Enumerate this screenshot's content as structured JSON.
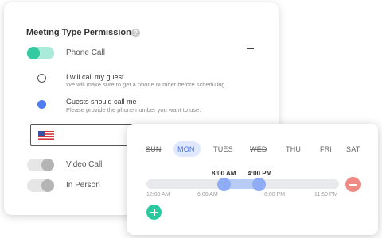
{
  "permissions": {
    "title": "Meeting Type Permissions",
    "help_icon": "?",
    "options": [
      {
        "label": "Phone Call",
        "enabled": true
      },
      {
        "label": "Video Call",
        "enabled": false
      },
      {
        "label": "In Person",
        "enabled": false
      }
    ],
    "phone_choices": [
      {
        "title": "I will call my guest",
        "description": "We will make sure to get a phone number before scheduling.",
        "selected": false
      },
      {
        "title": "Guests should call me",
        "description": "Please provide the phone number you want to use.",
        "selected": true
      }
    ],
    "phone_field": {
      "value": "",
      "country_flag": "us-flag-icon"
    }
  },
  "availability": {
    "days": [
      {
        "label": "SUN",
        "available": false,
        "selected": false
      },
      {
        "label": "MON",
        "available": true,
        "selected": true
      },
      {
        "label": "TUES",
        "available": true,
        "selected": false
      },
      {
        "label": "WED",
        "available": false,
        "selected": false
      },
      {
        "label": "THU",
        "available": true,
        "selected": false
      },
      {
        "label": "FRI",
        "available": true,
        "selected": false
      },
      {
        "label": "SAT",
        "available": true,
        "selected": false
      }
    ],
    "range": {
      "start": "8:00 AM",
      "end": "4:00 PM"
    },
    "ticks": [
      "12:00 AM",
      "6:00 AM",
      "6:00 PM",
      "11:59 PM"
    ]
  },
  "colors": {
    "accent_green": "#33c9a1",
    "accent_blue": "#4f7df5",
    "remove_red": "#f08a85"
  }
}
